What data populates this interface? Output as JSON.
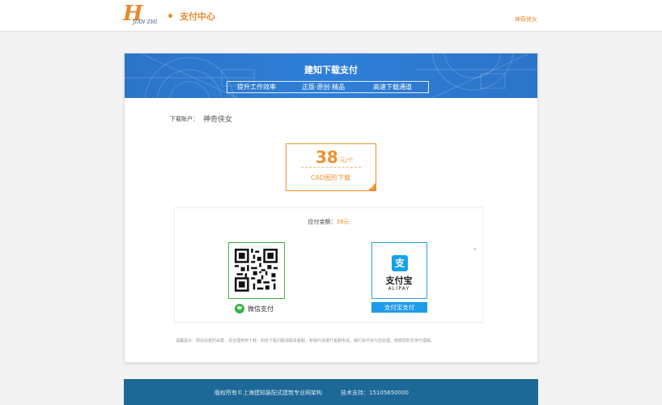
{
  "header": {
    "logo_text": "H",
    "logo_sub": "JIAN ZHI",
    "section_title": "支付中心",
    "user_name": "神奇侠女"
  },
  "banner": {
    "title": "建知下载支付",
    "tags": [
      "提升工作效率",
      "正版·原创·精品",
      "高速下载通道"
    ]
  },
  "account": {
    "label": "下载账户：",
    "value": "神奇侠女"
  },
  "price": {
    "amount": "38",
    "unit": "元/个",
    "type": "CAD图形下载"
  },
  "payment": {
    "amount_label": "应付金额：",
    "amount_value": "38元",
    "wechat_label": "微信支付",
    "alipay_logo_char": "支",
    "alipay_name": "支付宝",
    "alipay_en": "ALIPAY",
    "alipay_button": "支付宝支付"
  },
  "tip": "温馨提示：网站设置防采集，请合理使用下载，如有下载问题请联系客服，有疑问请拨打客服电话，我们会尽快为您处理，感谢您的支持与理解。",
  "footer": {
    "copyright": "版权所有©上海建知装配式建筑专业网架构",
    "support": "技术支持：15105650000"
  },
  "colors": {
    "accent": "#e8892a",
    "banner": "#2f7fd8",
    "wechat": "#3bb44a",
    "alipay": "#1e9be8",
    "footer": "#1c6897"
  }
}
